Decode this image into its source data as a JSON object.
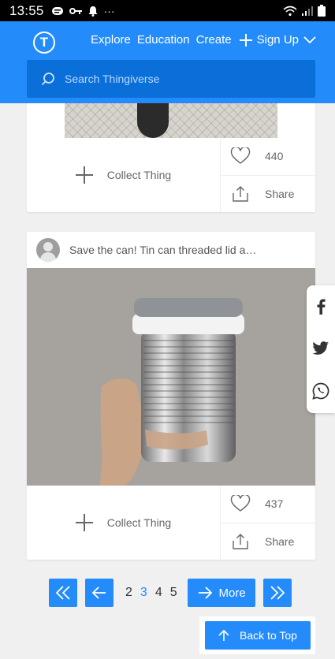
{
  "status_bar": {
    "time": "13:55",
    "dots": "···"
  },
  "header": {
    "logo_letter": "T",
    "nav": {
      "explore": "Explore",
      "education": "Education",
      "create": "Create",
      "sign_up": "Sign Up"
    },
    "search_placeholder": "Search Thingiverse",
    "color": "#248bfb"
  },
  "cards": [
    {
      "likes": "440",
      "collect_label": "Collect Thing",
      "share_label": "Share"
    },
    {
      "title": "Save the can! Tin can threaded lid a…",
      "likes": "437",
      "collect_label": "Collect Thing",
      "share_label": "Share"
    }
  ],
  "social": {
    "icons": [
      "facebook-icon",
      "twitter-icon",
      "whatsapp-icon"
    ]
  },
  "pagination": {
    "pages": [
      "2",
      "3",
      "4",
      "5"
    ],
    "current": "3",
    "more_label": "More"
  },
  "back_to_top": "Back to Top"
}
